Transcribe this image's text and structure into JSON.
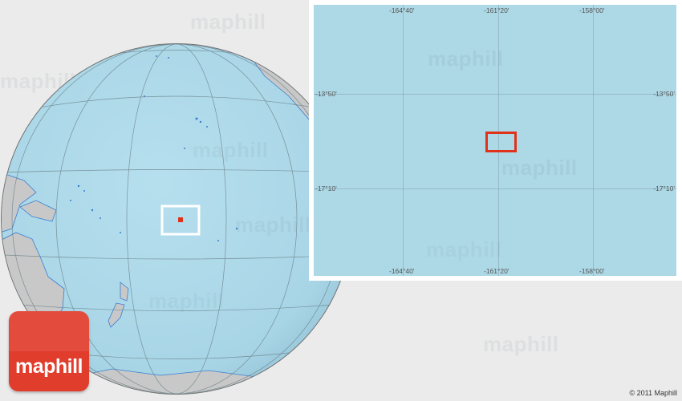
{
  "watermark": {
    "text": "maphill"
  },
  "inset": {
    "lon_top": [
      "-164°40'",
      "-161°20'",
      "-158°00'"
    ],
    "lon_bottom": [
      "-164°40'",
      "-161°20'",
      "-158°00'"
    ],
    "lat_left": [
      "-13°50'",
      "-17°10'"
    ],
    "lat_right": [
      "-13°50'",
      "-17°10'"
    ]
  },
  "logo": {
    "text": "maphill"
  },
  "copyright": "© 2011 Maphill",
  "colors": {
    "ocean": "#add8e6",
    "land": "#c8c8c8",
    "highlight": "#e0321a",
    "logo_bg": "#e13d2c",
    "background": "#ebebeb"
  }
}
